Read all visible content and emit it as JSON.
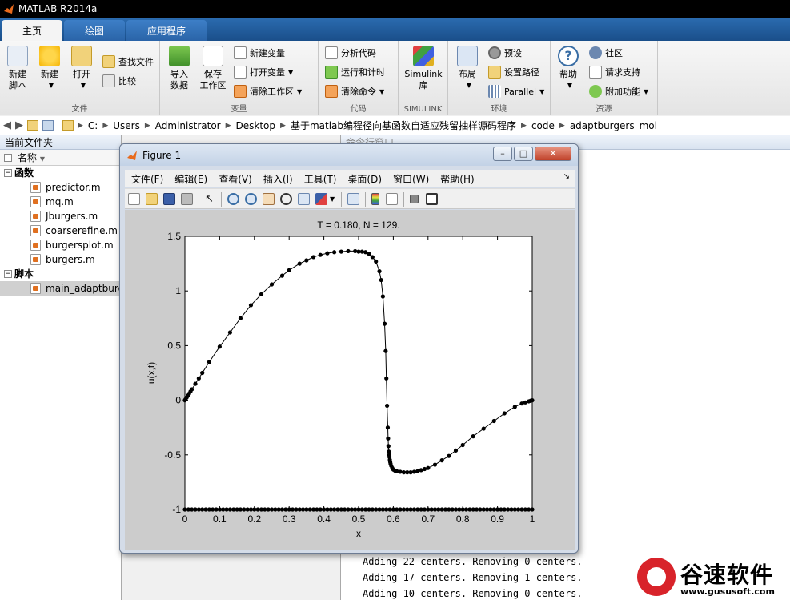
{
  "window": {
    "title": "MATLAB R2014a"
  },
  "tabs": [
    {
      "label": "主页",
      "active": true
    },
    {
      "label": "绘图",
      "active": false
    },
    {
      "label": "应用程序",
      "active": false
    }
  ],
  "ribbon": {
    "file": {
      "label": "文件",
      "new_script": "新建\n脚本",
      "new": "新建",
      "open": "打开",
      "find_files": "查找文件",
      "compare": "比较"
    },
    "variable": {
      "label": "变量",
      "import": "导入\n数据",
      "save": "保存\n工作区",
      "new_var": "新建变量",
      "open_var": "打开变量",
      "clear_ws": "清除工作区"
    },
    "code": {
      "label": "代码",
      "analyze": "分析代码",
      "run_time": "运行和计时",
      "clear_cmd": "清除命令"
    },
    "simulink": {
      "label": "SIMULINK",
      "lib": "Simulink\n库"
    },
    "environment": {
      "label": "环境",
      "layout": "布局",
      "prefs": "预设",
      "set_path": "设置路径",
      "parallel": "Parallel"
    },
    "resources": {
      "label": "资源",
      "help": "帮助",
      "community": "社区",
      "support": "请求支持",
      "addons": "附加功能"
    }
  },
  "address": {
    "segments": [
      "C:",
      "Users",
      "Administrator",
      "Desktop",
      "基于matlab编程径向基函数自适应残留抽样源码程序",
      "code",
      "adaptburgers_mol"
    ]
  },
  "current_folder": {
    "title": "当前文件夹",
    "column": "名称",
    "sections": [
      {
        "name": "函数",
        "files": [
          "predictor.m",
          "mq.m",
          "Jburgers.m",
          "coarserefine.m",
          "burgersplot.m",
          "burgers.m"
        ]
      },
      {
        "name": "脚本",
        "files": [
          "main_adaptburgers.m"
        ]
      }
    ]
  },
  "command_window": {
    "title": "命令行窗口",
    "lines": [
      "Adding 22 centers. Removing 0 centers.",
      "Adding 17 centers. Removing 1 centers.",
      "Adding 10 centers. Removing 0 centers."
    ]
  },
  "figure": {
    "title": "Figure 1",
    "menu": [
      "文件(F)",
      "编辑(E)",
      "查看(V)",
      "插入(I)",
      "工具(T)",
      "桌面(D)",
      "窗口(W)",
      "帮助(H)"
    ]
  },
  "watermark": {
    "brand": "谷速软件",
    "url": "www.gususoft.com"
  },
  "chart_data": {
    "type": "scatter",
    "title": "T = 0.180,    N = 129.",
    "xlabel": "x",
    "ylabel": "u(x,t)",
    "xlim": [
      0,
      1
    ],
    "ylim": [
      -1,
      1.5
    ],
    "xticks": [
      "0",
      "0.1",
      "0.2",
      "0.3",
      "0.4",
      "0.5",
      "0.6",
      "0.7",
      "0.8",
      "0.9",
      "1"
    ],
    "yticks": [
      "-1",
      "-0.5",
      "0",
      "0.5",
      "1",
      "1.5"
    ],
    "series": [
      {
        "style": "line-with-markers",
        "x": [
          0,
          0.002,
          0.005,
          0.008,
          0.012,
          0.016,
          0.02,
          0.03,
          0.04,
          0.05,
          0.07,
          0.1,
          0.13,
          0.16,
          0.19,
          0.22,
          0.25,
          0.28,
          0.3,
          0.33,
          0.35,
          0.37,
          0.39,
          0.41,
          0.43,
          0.45,
          0.47,
          0.49,
          0.5,
          0.51,
          0.52,
          0.53,
          0.54,
          0.55,
          0.56,
          0.565,
          0.57,
          0.575,
          0.578,
          0.58,
          0.582,
          0.584,
          0.585,
          0.586,
          0.587,
          0.588,
          0.589,
          0.59,
          0.591,
          0.592,
          0.594,
          0.597,
          0.6,
          0.605,
          0.61,
          0.62,
          0.63,
          0.64,
          0.65,
          0.66,
          0.67,
          0.68,
          0.69,
          0.7,
          0.72,
          0.74,
          0.76,
          0.78,
          0.8,
          0.83,
          0.86,
          0.89,
          0.92,
          0.95,
          0.97,
          0.98,
          0.99,
          0.995,
          1
        ],
        "y": [
          0,
          0.01,
          0.025,
          0.04,
          0.06,
          0.08,
          0.1,
          0.15,
          0.2,
          0.25,
          0.35,
          0.49,
          0.62,
          0.75,
          0.87,
          0.97,
          1.06,
          1.14,
          1.19,
          1.25,
          1.28,
          1.31,
          1.33,
          1.345,
          1.355,
          1.36,
          1.365,
          1.365,
          1.36,
          1.36,
          1.355,
          1.34,
          1.31,
          1.27,
          1.18,
          1.1,
          0.95,
          0.7,
          0.45,
          0.2,
          -0.05,
          -0.25,
          -0.35,
          -0.42,
          -0.47,
          -0.5,
          -0.52,
          -0.545,
          -0.565,
          -0.58,
          -0.6,
          -0.62,
          -0.635,
          -0.645,
          -0.65,
          -0.655,
          -0.66,
          -0.66,
          -0.66,
          -0.655,
          -0.65,
          -0.64,
          -0.63,
          -0.62,
          -0.59,
          -0.55,
          -0.51,
          -0.46,
          -0.41,
          -0.33,
          -0.26,
          -0.19,
          -0.12,
          -0.06,
          -0.03,
          -0.02,
          -0.01,
          -0.005,
          0
        ]
      },
      {
        "style": "markers-baseline",
        "x": [
          0,
          0.01,
          0.02,
          0.03,
          0.04,
          0.05,
          0.06,
          0.07,
          0.08,
          0.09,
          0.1,
          0.11,
          0.12,
          0.13,
          0.14,
          0.15,
          0.16,
          0.17,
          0.18,
          0.19,
          0.2,
          0.21,
          0.22,
          0.23,
          0.24,
          0.25,
          0.26,
          0.27,
          0.28,
          0.29,
          0.3,
          0.31,
          0.32,
          0.33,
          0.34,
          0.35,
          0.36,
          0.37,
          0.38,
          0.39,
          0.4,
          0.41,
          0.42,
          0.43,
          0.44,
          0.45,
          0.46,
          0.47,
          0.48,
          0.49,
          0.5,
          0.51,
          0.52,
          0.53,
          0.54,
          0.55,
          0.56,
          0.57,
          0.58,
          0.59,
          0.6,
          0.61,
          0.62,
          0.63,
          0.64,
          0.65,
          0.66,
          0.67,
          0.68,
          0.69,
          0.7,
          0.71,
          0.72,
          0.73,
          0.74,
          0.75,
          0.76,
          0.77,
          0.78,
          0.79,
          0.8,
          0.81,
          0.82,
          0.83,
          0.84,
          0.85,
          0.86,
          0.87,
          0.88,
          0.89,
          0.9,
          0.91,
          0.92,
          0.93,
          0.94,
          0.95,
          0.96,
          0.97,
          0.98,
          0.99,
          1
        ],
        "y": -1
      }
    ]
  }
}
